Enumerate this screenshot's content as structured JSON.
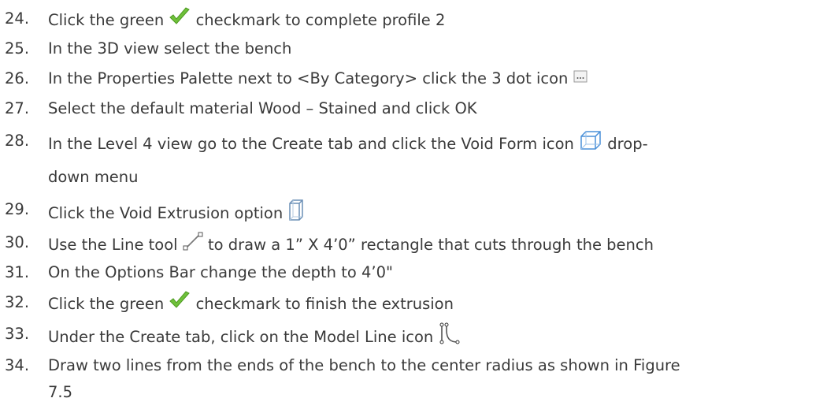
{
  "steps": [
    {
      "num": "24.",
      "parts": [
        "Click the green ",
        "check-icon",
        " checkmark to complete profile 2"
      ]
    },
    {
      "num": "25.",
      "parts": [
        "In the 3D view select the bench"
      ]
    },
    {
      "num": "26.",
      "parts": [
        "In the Properties Palette next to <By Category> click the 3 dot icon ",
        "dots-icon"
      ]
    },
    {
      "num": "27.",
      "parts": [
        "Select the default material Wood – Stained and click OK"
      ]
    },
    {
      "num": "28.",
      "parts": [
        "In the Level 4 view go to the Create tab and click the Void Form icon ",
        "void-form-icon",
        " drop-"
      ],
      "cont": "down menu"
    },
    {
      "num": "29.",
      "parts": [
        "Click the Void Extrusion option ",
        "void-extrusion-icon"
      ]
    },
    {
      "num": "30.",
      "parts": [
        "Use the Line tool ",
        "line-tool-icon",
        " to draw a 1” X 4’0” rectangle that cuts through the bench"
      ]
    },
    {
      "num": "31.",
      "parts": [
        "On the Options Bar change the depth to 4’0\""
      ]
    },
    {
      "num": "32.",
      "parts": [
        "Click the green ",
        "check-icon",
        " checkmark to finish the extrusion"
      ]
    },
    {
      "num": "33.",
      "parts": [
        "Under the Create tab, click on the Model Line icon ",
        "model-line-icon"
      ]
    },
    {
      "num": "34.",
      "parts": [
        "Draw two lines from the ends of the bench to the center radius as shown in Figure"
      ],
      "cont": "7.5"
    }
  ],
  "colors": {
    "text": "#3a3a3a",
    "check": "#6fc13a",
    "icon_blue": "#4a90d9",
    "icon_gray": "#777777"
  }
}
